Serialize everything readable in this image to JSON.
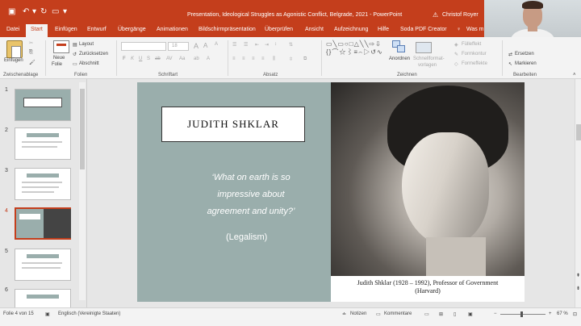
{
  "titlebar": {
    "doc_title": "Presentation, Ideological Struggles as Agonistic Conflict, Belgrade, 2021  -  PowerPoint",
    "user": "Christof Royer"
  },
  "tabs": [
    "Datei",
    "Start",
    "Einfügen",
    "Entwurf",
    "Übergänge",
    "Animationen",
    "Bildschirmpräsentation",
    "Überprüfen",
    "Ansicht",
    "Aufzeichnung",
    "Hilfe",
    "Soda PDF Creator",
    "Was m"
  ],
  "ribbon": {
    "paste": "Einfügen",
    "new_slide_1": "Neue",
    "new_slide_2": "Folie",
    "layout": "Layout",
    "reset": "Zurücksetzen",
    "section": "Abschnitt",
    "font_size": "18",
    "arrange": "Anordnen",
    "quick_styles_1": "Schnellformat-",
    "quick_styles_2": "vorlagen",
    "fill": "Fülleffekt",
    "outline": "Formkontur",
    "effects": "Formeffekte",
    "replace": "Ersetzen",
    "select": "Markieren",
    "groups": {
      "clipboard": "Zwischenablage",
      "slides": "Folien",
      "font": "Schriftart",
      "paragraph": "Absatz",
      "drawing": "Zeichnen",
      "editing": "Bearbeiten"
    }
  },
  "thumbnails": [
    "1",
    "2",
    "3",
    "4",
    "5",
    "6"
  ],
  "slide": {
    "title": "JUDITH SHKLAR",
    "quote_line1": "‘What on earth is so",
    "quote_line2": "impressive about",
    "quote_line3": "agreement and unity?’",
    "quote_source": "(Legalism)",
    "caption_line1": "Judith Shklar (1928 – 1992), Professor of Government",
    "caption_line2": "(Harvard)"
  },
  "status": {
    "slide_info": "Folie 4 von 15",
    "language": "Englisch (Vereinigte Staaten)",
    "notes": "Notizen",
    "comments": "Kommentare",
    "zoom": "67 %"
  }
}
